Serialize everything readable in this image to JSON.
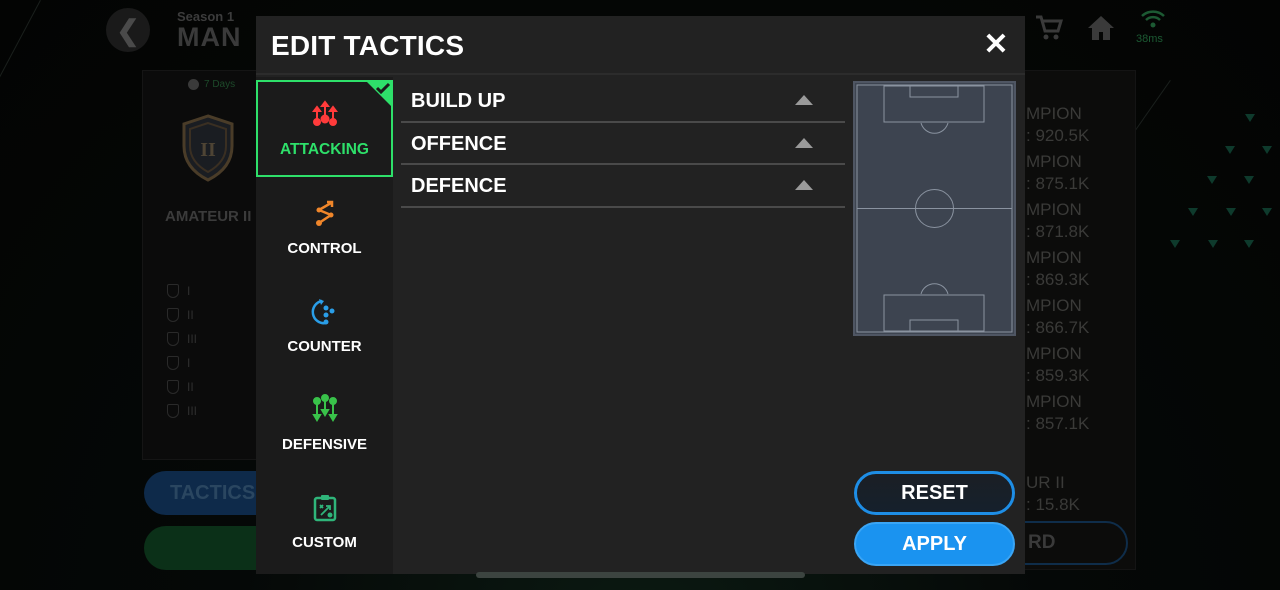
{
  "background": {
    "season_label": "Season 1",
    "season_title": "MAN",
    "ping": "38ms",
    "days_left": "7 Days",
    "rank_label": "AMATEUR II",
    "rank_tiers": [
      "I",
      "II",
      "III",
      "I",
      "II",
      "III"
    ],
    "tactics_button": "TACTICS",
    "leaderboard": [
      {
        "title": "MPION",
        "value": ": 920.5K"
      },
      {
        "title": "MPION",
        "value": ": 875.1K"
      },
      {
        "title": "MPION",
        "value": ": 871.8K"
      },
      {
        "title": "MPION",
        "value": ": 869.3K"
      },
      {
        "title": "MPION",
        "value": ": 866.7K"
      },
      {
        "title": "MPION",
        "value": ": 859.3K"
      },
      {
        "title": "MPION",
        "value": ": 857.1K"
      }
    ],
    "own_rank": {
      "title": "UR II",
      "value": ": 15.8K"
    },
    "board_button": "RD",
    "icons": [
      "back-icon",
      "cart-icon",
      "home-icon",
      "wifi-icon"
    ]
  },
  "modal": {
    "title": "EDIT TACTICS",
    "close_icon": "close-icon",
    "sidebar": [
      {
        "label": "ATTACKING",
        "icon": "attacking-icon",
        "color": "#ff3b3b",
        "active": true
      },
      {
        "label": "CONTROL",
        "icon": "control-icon",
        "color": "#f0862a",
        "active": false
      },
      {
        "label": "COUNTER",
        "icon": "counter-icon",
        "color": "#2a9ee8",
        "active": false
      },
      {
        "label": "DEFENSIVE",
        "icon": "defensive-icon",
        "color": "#39c24a",
        "active": false
      },
      {
        "label": "CUSTOM",
        "icon": "custom-icon",
        "color": "#2fb57a",
        "active": false
      }
    ],
    "sections": [
      {
        "label": "BUILD UP",
        "expanded": false
      },
      {
        "label": "OFFENCE",
        "expanded": false
      },
      {
        "label": "DEFENCE",
        "expanded": false
      }
    ],
    "reset_label": "RESET",
    "apply_label": "APPLY"
  },
  "colors": {
    "accent_green": "#2ee06a",
    "accent_blue": "#1a93f0",
    "modal_bg": "#222222"
  }
}
